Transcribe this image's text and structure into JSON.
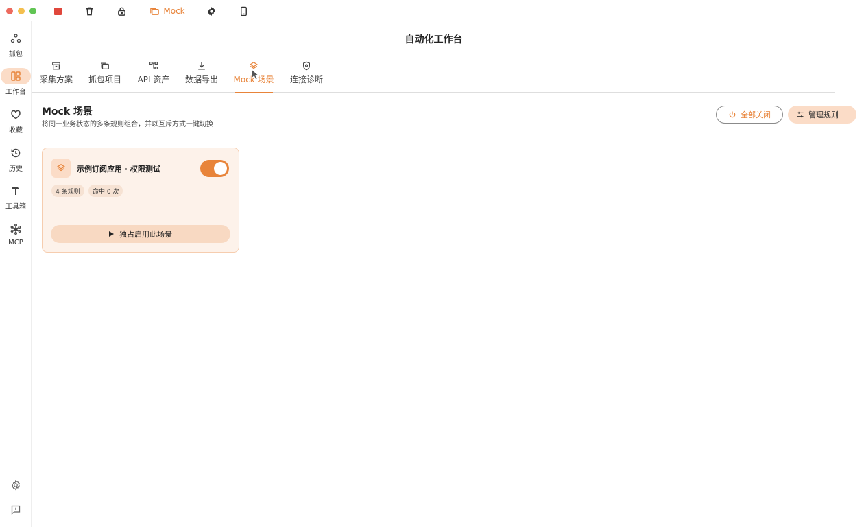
{
  "titlebar": {
    "mock_label": "Mock"
  },
  "rail": {
    "items": [
      {
        "label": "抓包",
        "icon": "nodes-icon"
      },
      {
        "label": "工作台",
        "icon": "dashboard-icon"
      },
      {
        "label": "收藏",
        "icon": "heart-icon"
      },
      {
        "label": "历史",
        "icon": "history-icon"
      },
      {
        "label": "工具箱",
        "icon": "hammer-icon"
      },
      {
        "label": "MCP",
        "icon": "network-icon"
      }
    ]
  },
  "page": {
    "title": "自动化工作台"
  },
  "tabs": [
    {
      "label": "采集方案",
      "icon": "archive-icon"
    },
    {
      "label": "抓包项目",
      "icon": "folders-icon"
    },
    {
      "label": "API 资产",
      "icon": "tree-icon"
    },
    {
      "label": "数据导出",
      "icon": "download-icon"
    },
    {
      "label": "Mock 场景",
      "icon": "layers-icon"
    },
    {
      "label": "连接诊断",
      "icon": "shield-icon"
    }
  ],
  "active_tab": "Mock 场景",
  "section": {
    "title": "Mock 场景",
    "subtitle": "将同一业务状态的多条规则组合，并以互斥方式一键切换",
    "close_all_label": "全部关闭",
    "manage_label": "管理规则"
  },
  "scenario_card": {
    "title": "示例订阅应用 · 权限测试",
    "enabled": true,
    "rules_chip": "4 条规则",
    "hits_chip": "命中 0 次",
    "action_label": "独占启用此场景"
  },
  "colors": {
    "accent": "#e8843a",
    "accent_soft": "#fbdcc7",
    "card_bg": "#fdf2ea",
    "stop_red": "#e0473c"
  }
}
